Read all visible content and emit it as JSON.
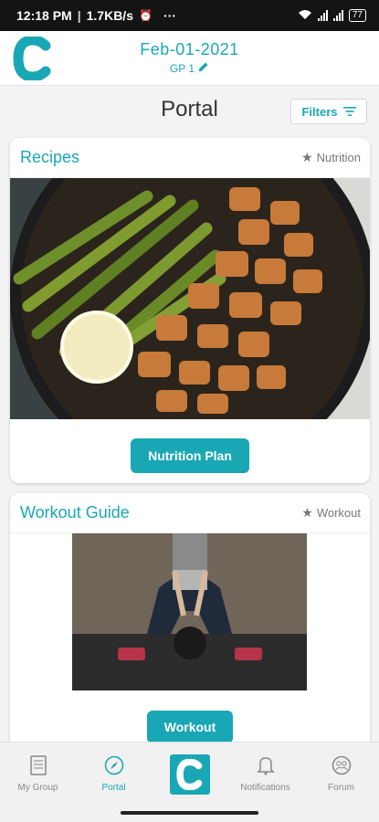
{
  "status": {
    "time": "12:18 PM",
    "speed": "1.7KB/s",
    "more": "···",
    "battery": "77"
  },
  "header": {
    "date": "Feb-01-2021",
    "group": "GP 1"
  },
  "page": {
    "title": "Portal",
    "filters_label": "Filters"
  },
  "cards": [
    {
      "title": "Recipes",
      "tag": "Nutrition",
      "button": "Nutrition Plan"
    },
    {
      "title": "Workout Guide",
      "tag": "Workout",
      "button": "Workout"
    }
  ],
  "nav": {
    "items": [
      "My Group",
      "Portal",
      "Notifications",
      "Forum"
    ],
    "active": "Portal"
  },
  "colors": {
    "accent": "#1aa7b5",
    "status_bar": "#141414"
  }
}
